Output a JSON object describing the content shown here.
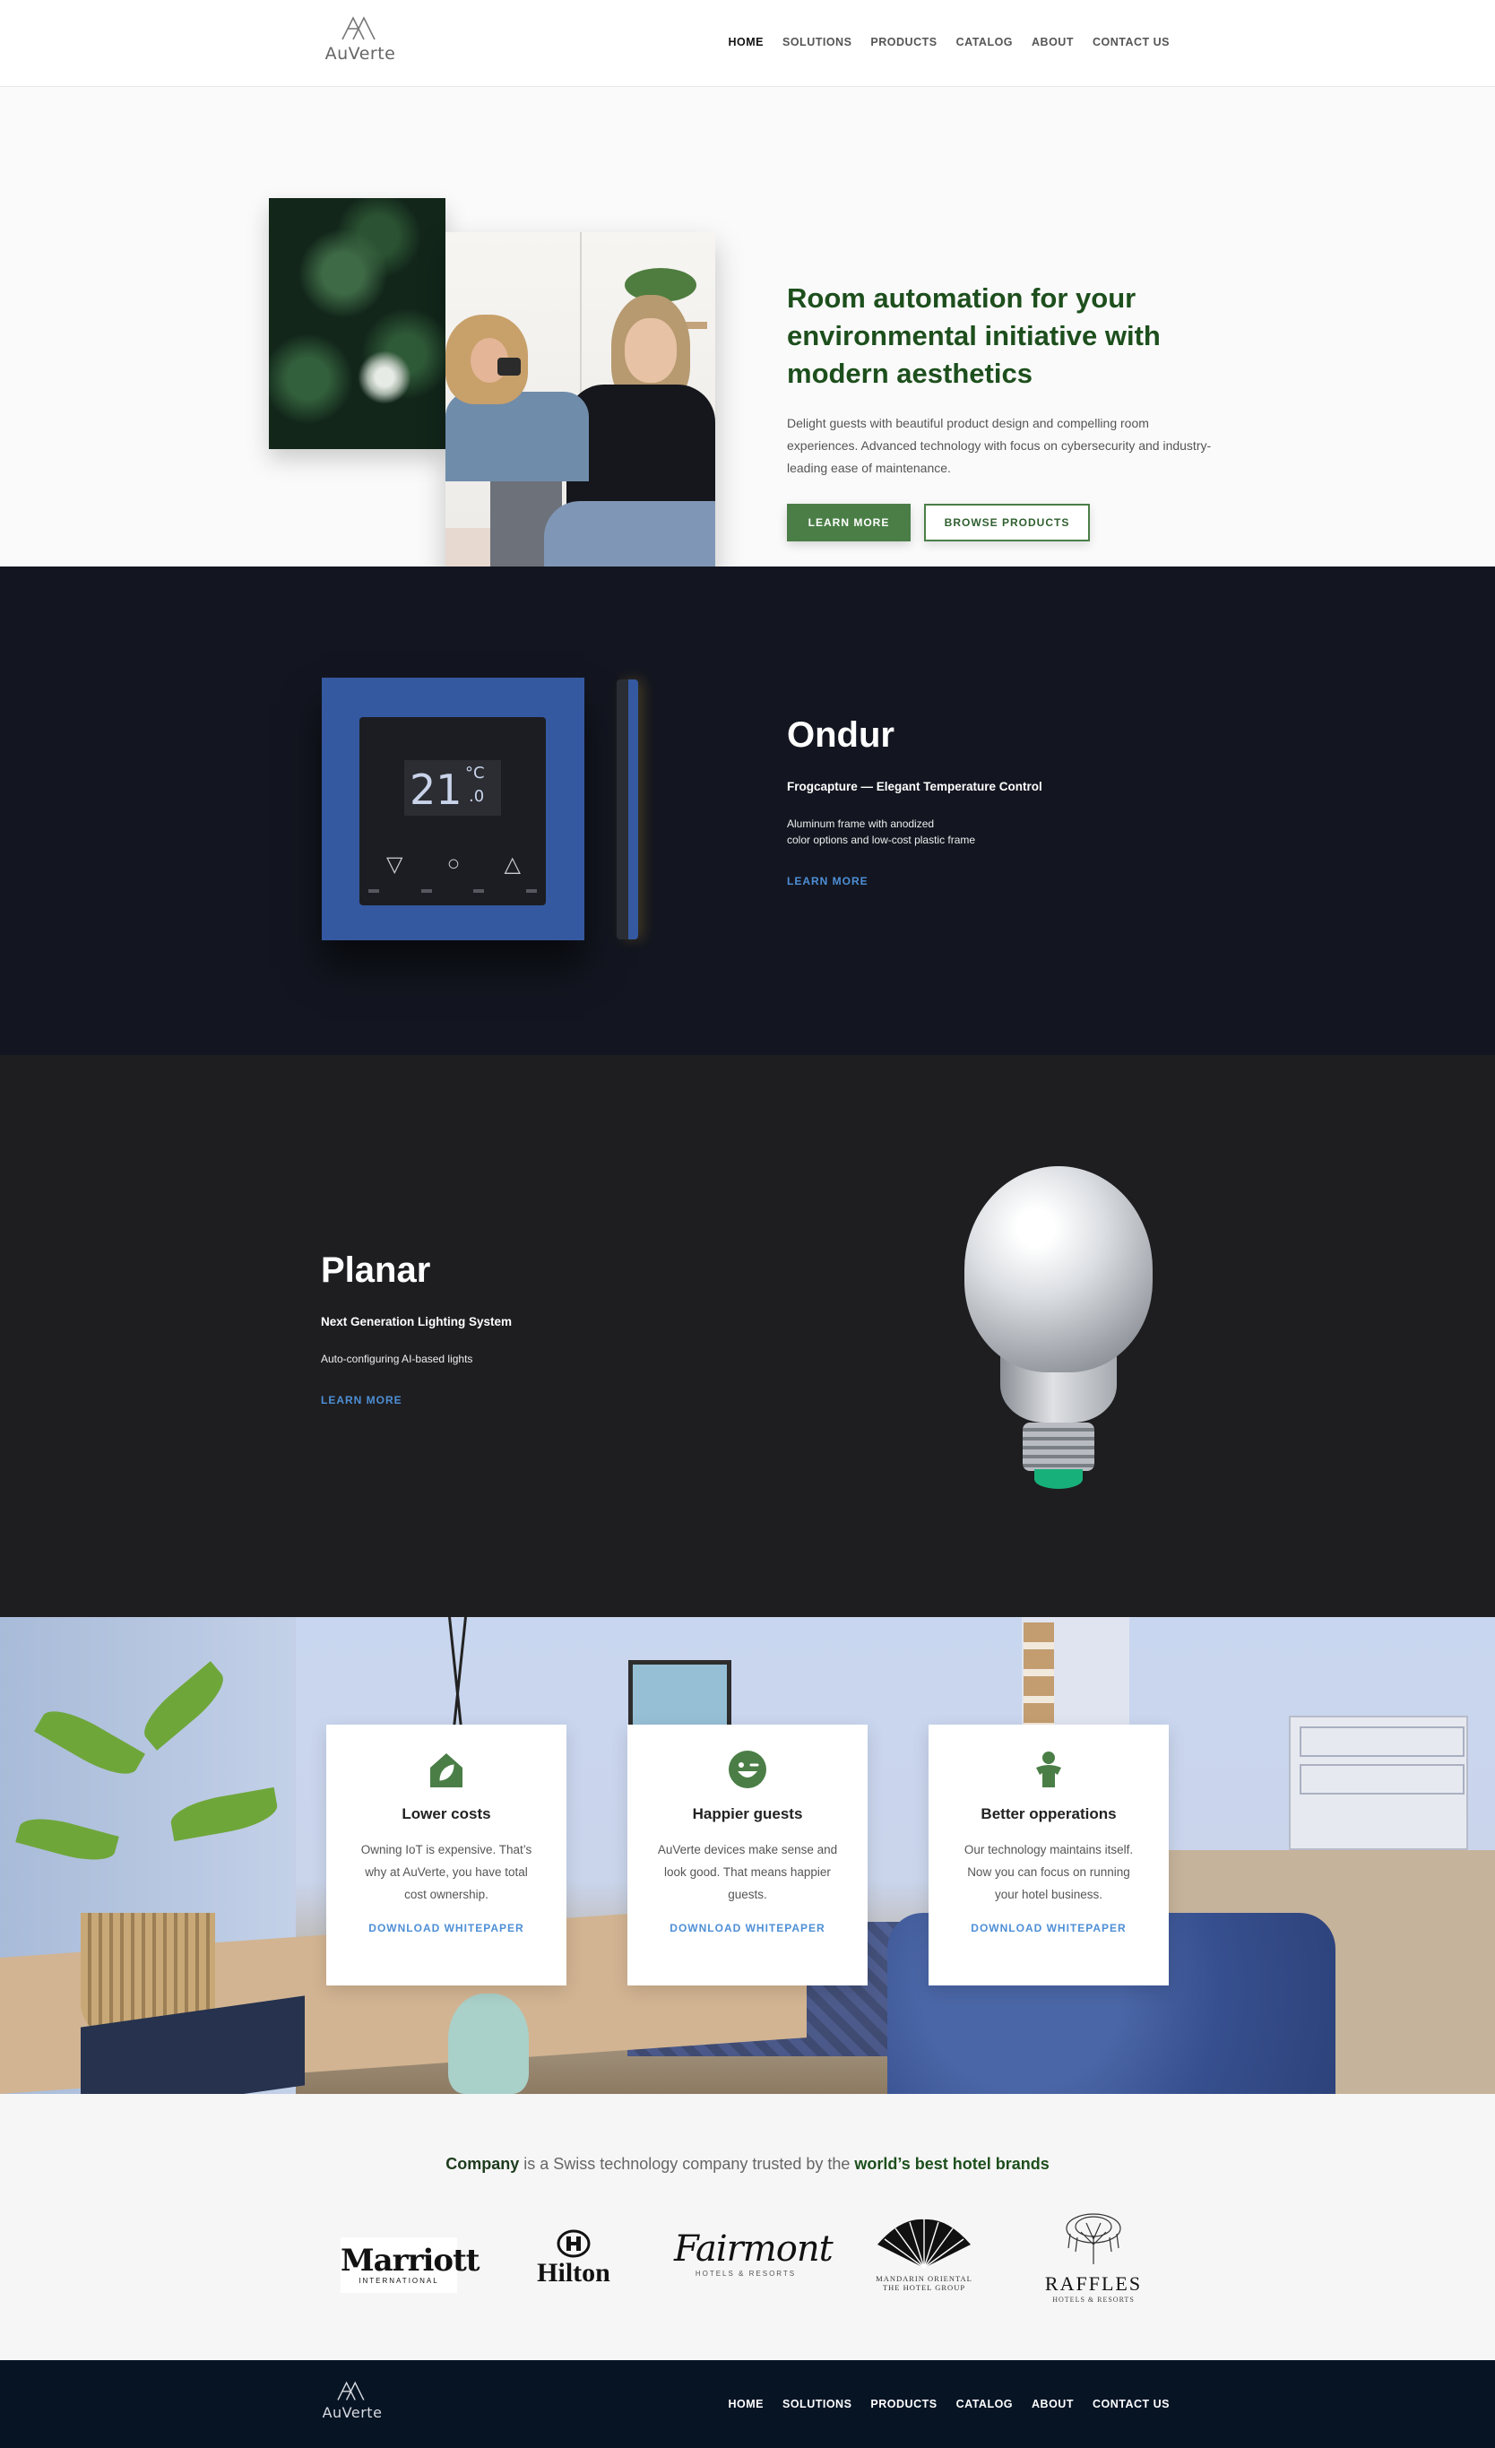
{
  "brand": {
    "name": "AuVerte"
  },
  "nav": {
    "items": [
      "HOME",
      "SOLUTIONS",
      "PRODUCTS",
      "CATALOG",
      "ABOUT",
      "CONTACT US"
    ],
    "active": "HOME"
  },
  "hero": {
    "title": "Room automation for your environmental initiative with modern aesthetics",
    "description": "Delight guests with beautiful product design and compelling room experiences. Advanced technology with focus on cybersecurity and industry-leading ease of maintenance.",
    "primary_button": "LEARN MORE",
    "secondary_button": "BROWSE PRODUCTS"
  },
  "products": [
    {
      "name": "Ondur",
      "subtitle": "Frogcapture — Elegant Temperature Control",
      "description": "Aluminum frame with anodized\ncolor options and low-cost plastic frame",
      "link": "LEARN MORE",
      "display": {
        "temp_main": "21",
        "temp_unit": "°C",
        "temp_decimal": ".0"
      }
    },
    {
      "name": "Planar",
      "subtitle": "Next Generation Lighting System",
      "description": "Auto-configuring AI-based lights",
      "link": "LEARN MORE"
    }
  ],
  "features": [
    {
      "icon": "house-leaf-icon",
      "title": "Lower costs",
      "description": "Owning IoT is expensive. That’s why at AuVerte, you have total cost ownership.",
      "link": "DOWNLOAD WHITEPAPER"
    },
    {
      "icon": "smile-wink-icon",
      "title": "Happier guests",
      "description": "AuVerte devices make sense and look good. That means happier guests.",
      "link": "DOWNLOAD WHITEPAPER"
    },
    {
      "icon": "person-icon",
      "title": "Better opperations",
      "description": "Our technology maintains itself. Now you can focus on running your hotel business.",
      "link": "DOWNLOAD WHITEPAPER"
    }
  ],
  "trust": {
    "company": "Company",
    "middle": " is a Swiss technology company trusted by the ",
    "emphasis": "world’s best hotel brands"
  },
  "brands": [
    {
      "name": "Marriott",
      "tagline": "INTERNATIONAL"
    },
    {
      "name": "Hilton",
      "tagline": ""
    },
    {
      "name": "Fairmont",
      "tagline": "HOTELS & RESORTS"
    },
    {
      "name": "MANDARIN ORIENTAL",
      "tagline": "THE HOTEL GROUP"
    },
    {
      "name": "RAFFLES",
      "tagline": "HOTELS & RESORTS"
    }
  ],
  "colors": {
    "brand_green": "#4a7e46",
    "title_green": "#1d4f1d",
    "link_blue": "#4e8fd6",
    "dark_navy": "#131620",
    "footer_navy": "#071424"
  }
}
